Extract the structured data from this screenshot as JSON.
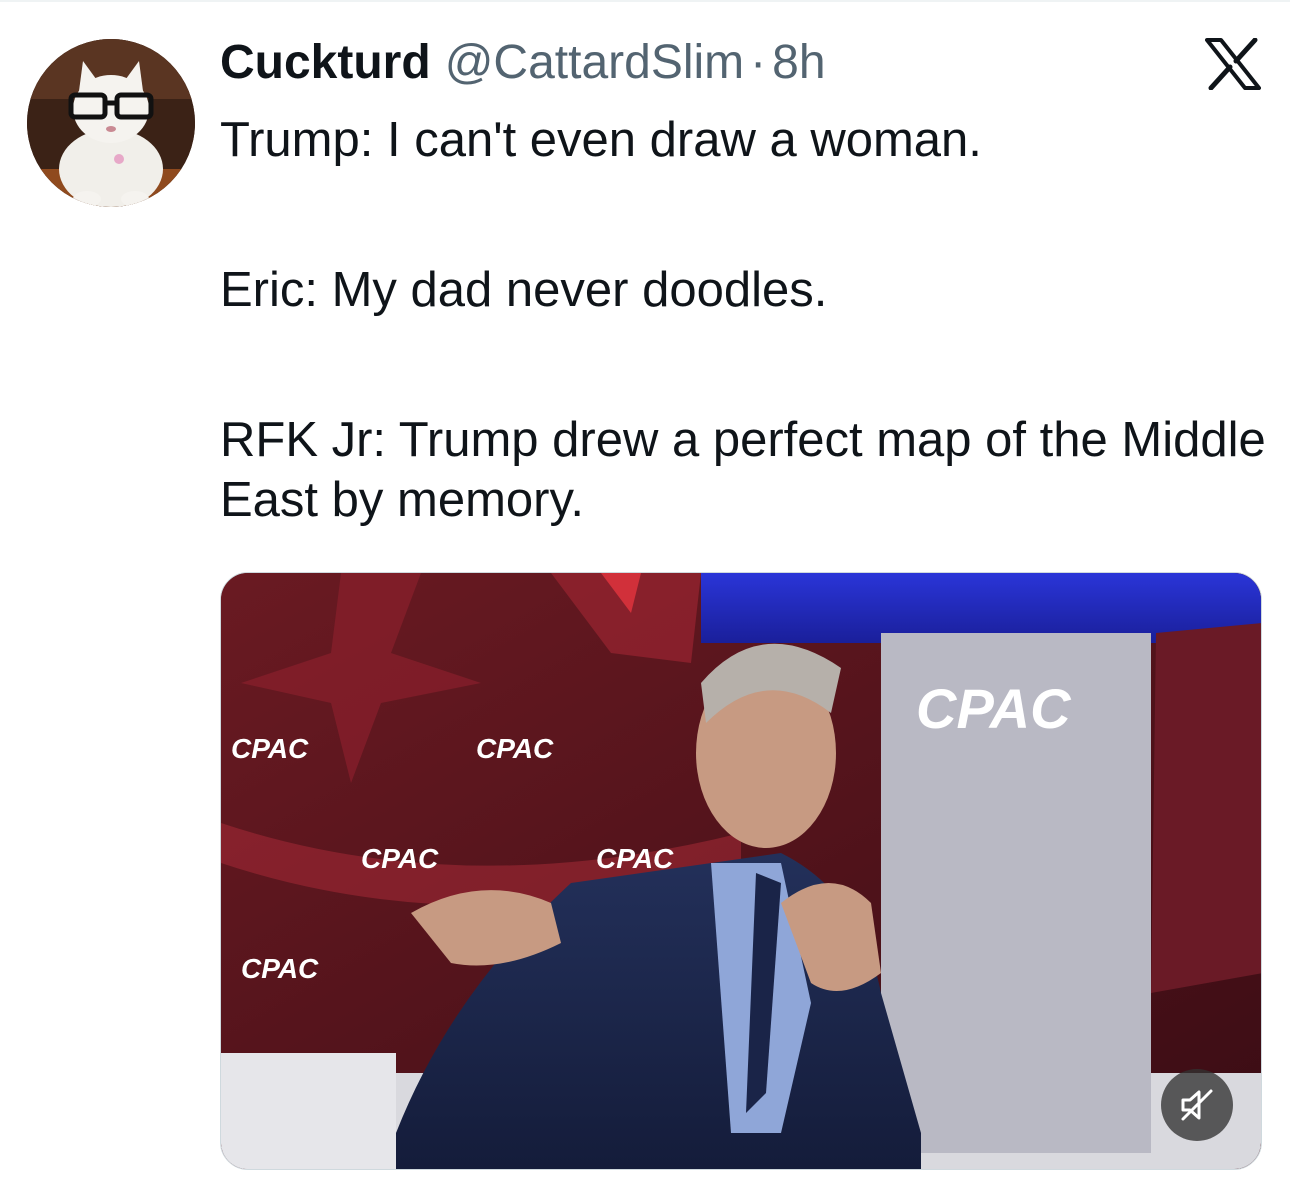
{
  "tweet": {
    "display_name": "Cuckturd",
    "handle": "@CattardSlim",
    "separator": "·",
    "time": "8h",
    "text_paragraphs": [
      "Trump: I can't even draw a woman.",
      "Eric: My dad never doodles.",
      "RFK Jr: Trump drew a perfect map of the Middle East by memory."
    ]
  },
  "media": {
    "type": "video",
    "backdrop_logo": "CPAC",
    "mute_icon": "speaker-muted-icon"
  },
  "icons": {
    "logo": "x-logo-icon",
    "avatar": "cat-with-glasses-avatar"
  },
  "colors": {
    "text_primary": "#0f1419",
    "text_secondary": "#536471",
    "border": "#cfd9de"
  }
}
